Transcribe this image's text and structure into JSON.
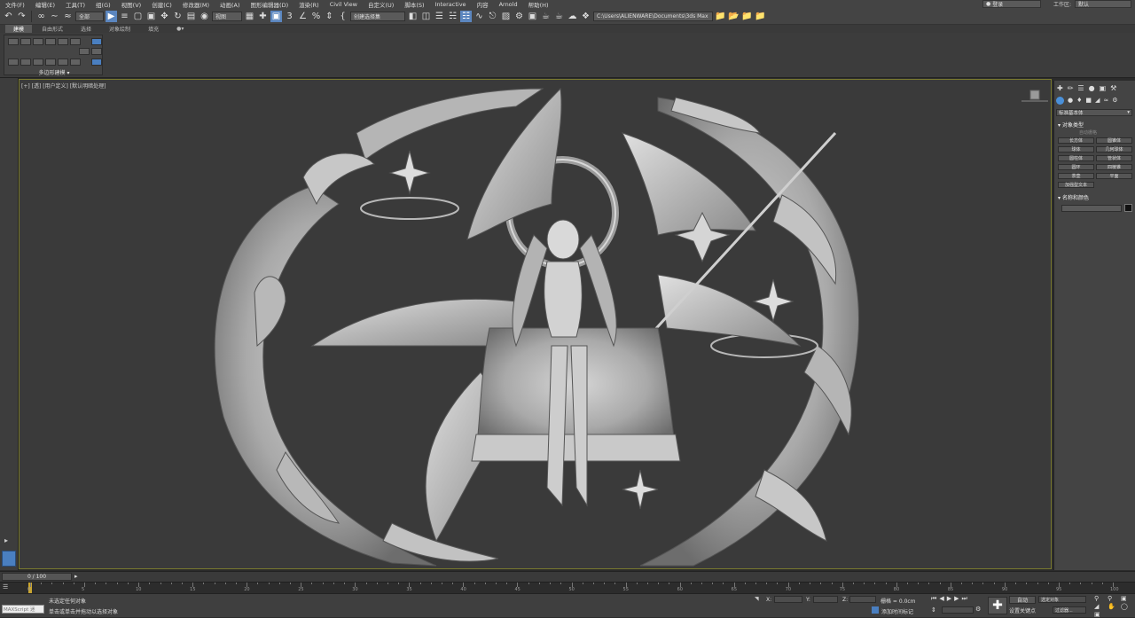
{
  "menu": {
    "items": [
      "文件(F)",
      "编辑(E)",
      "工具(T)",
      "组(G)",
      "视图(V)",
      "创建(C)",
      "修改器(M)",
      "动画(A)",
      "图形编辑器(D)",
      "渲染(R)",
      "Civil View",
      "自定义(U)",
      "脚本(S)",
      "Interactive",
      "内容",
      "Arnold",
      "帮助(H)"
    ],
    "login": "登录",
    "workspace_label": "工作区:",
    "workspace_value": "默认"
  },
  "toolbar": {
    "selection_filter": "全部",
    "ref_coord": "视图",
    "named_selection": "创建选择集",
    "project_path": "C:\\Users\\ALIENWARE\\Documents\\3ds Max 2020"
  },
  "ribbon": {
    "tabs": [
      "建模",
      "自由形式",
      "选择",
      "对象绘制",
      "填充"
    ],
    "panel_label": "多边形建模"
  },
  "viewport": {
    "label": "[+] [透] [用户定义] [默认明暗处理]"
  },
  "command_panel": {
    "category": "标准基本体",
    "rollout_object_type": "对象类型",
    "autogrid": "自动栅格",
    "primitives": [
      "长方体",
      "圆锥体",
      "球体",
      "几何球体",
      "圆柱体",
      "管状体",
      "圆环",
      "四棱锥",
      "茶壶",
      "平面",
      "加强型文本"
    ],
    "rollout_name_color": "名称和颜色",
    "accent": "#4a90d9"
  },
  "timeline": {
    "frame_counter": "0 / 100",
    "ticks": [
      "0",
      "5",
      "10",
      "15",
      "20",
      "25",
      "30",
      "35",
      "40",
      "45",
      "50",
      "55",
      "60",
      "65",
      "70",
      "75",
      "80",
      "85",
      "90",
      "95",
      "100"
    ]
  },
  "status": {
    "maxscript": "MAXScript 迷",
    "line1": "未选定任何对象",
    "line2": "单击或单击并拖动以选择对象",
    "x_label": "X:",
    "y_label": "Y:",
    "z_label": "Z:",
    "grid": "栅格 = 0.0cm",
    "add_time_tag": "添加时间标记",
    "auto": "自动",
    "set_key": "设置关键点",
    "selected_object": "选定对象",
    "key_filters": "过滤器..."
  }
}
